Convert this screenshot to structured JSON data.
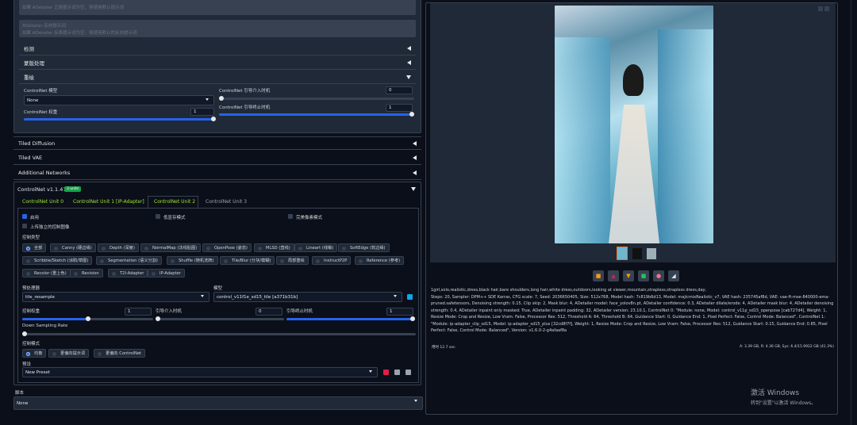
{
  "adetailer": {
    "neg_hint": "如果 ADetailer 正面提示词为空，将使用默认提示词",
    "neg_label": "ADetailer 反向提示词",
    "neg_hint2": "如果 ADetailer 反面提示词为空，将使用默认的反向提示词"
  },
  "sections": {
    "detect": "检测",
    "mask": "蒙版处理",
    "redraw": "重绘"
  },
  "cn_inner": {
    "model_label": "ControlNet 模型",
    "model_value": "None",
    "weight_label": "ControlNet 权重",
    "weight_value": "1",
    "guid_start_label": "ControlNet 引导介入时机",
    "guid_start_value": "0",
    "guid_end_label": "ControlNet 引导终止时机",
    "guid_end_value": "1"
  },
  "accordions": {
    "tiled_diffusion": "Tiled Diffusion",
    "tiled_vae": "Tiled VAE",
    "additional_networks": "Additional Networks"
  },
  "controlnet": {
    "title": "ControlNet v1.1.411",
    "badge": "3 units",
    "tabs": [
      "ControlNet Unit 0",
      "ControlNet Unit 1 [IP-Adapter]",
      "ControlNet Unit 2",
      "ControlNet Unit 3"
    ],
    "enable": "启用",
    "low_vram": "低显存模式",
    "pixel_perfect": "完美像素模式",
    "upload_independent": "上传独立的控制图像",
    "control_type_label": "控制类型",
    "control_types": [
      "全部",
      "Canny (硬边缘)",
      "Depth (深度)",
      "NormalMap (法线贴图)",
      "OpenPose (姿态)",
      "MLSD (直线)",
      "Lineart (线稿)",
      "SoftEdge (软边缘)",
      "Scribble/Sketch (涂鸦/草图)",
      "Segmentation (语义分割)",
      "Shuffle (随机洗牌)",
      "Tile/Blur (分块/模糊)",
      "局部重绘",
      "InstructP2P",
      "Reference (参考)",
      "Recolor (重上色)",
      "Revision",
      "T2I-Adapter",
      "IP-Adapter"
    ],
    "preprocessor_label": "预处理器",
    "preprocessor_value": "tile_resample",
    "model_label": "模型",
    "model_value": "control_v11f1e_sd15_tile [a371b31b]",
    "weight_label": "控制权重",
    "weight_value": "1",
    "start_label": "引导介入时机",
    "start_value": "0",
    "end_label": "引导终止时机",
    "end_value": "1",
    "downsample_label": "Down Sampling Rate",
    "downsample_value": "1",
    "mode_label": "控制模式",
    "modes": [
      "均衡",
      "更偏向提示词",
      "更偏向 ControlNet"
    ],
    "preset_label": "预设",
    "preset_value": "New Preset"
  },
  "script": {
    "label": "脚本",
    "value": "None"
  },
  "gallery": {
    "thumbs_count": 3
  },
  "info": {
    "prompt": "1girl,solo,realistic,dress,black hair,bare shoulders,long hair,white dress,outdoors,looking at viewer,mountain,strapless,strapless dress,day,",
    "params": "Steps: 20, Sampler: DPM++ SDE Karras, CFG scale: 7, Seed: 2036650405, Size: 512x768, Model hash: 7c819b6d13, Model: majicmixRealistic_v7, VAE hash: 235745af8d, VAE: vae-ft-mse-840000-ema-pruned.safetensors, Denoising strength: 0.15, Clip skip: 2, Mask blur: 4, ADetailer model: face_yolov8n.pt, ADetailer confidence: 0.3, ADetailer dilate/erode: 4, ADetailer mask blur: 4, ADetailer denoising strength: 0.4, ADetailer inpaint only masked: True, ADetailer inpaint padding: 32, ADetailer version: 23.10.1, ControlNet 0: \"Module: none, Model: control_v11p_sd15_openpose [cab727d4], Weight: 1, Resize Mode: Crop and Resize, Low Vram: False, Processor Res: 512, Threshold A: 64, Threshold B: 64, Guidance Start: 0, Guidance End: 1, Pixel Perfect: False, Control Mode: Balanced\", ControlNet 1: \"Module: ip-adapter_clip_sd15, Model: ip-adapter_sd15_plus [32cd8f7f], Weight: 1, Resize Mode: Crop and Resize, Low Vram: False, Processor Res: 512, Guidance Start: 0.15, Guidance End: 0.85, Pixel Perfect: False, Control Mode: Balanced\", Version: v1.6.0-2-g4afaaf8a",
    "time": "用时 12.7 sec.",
    "vram": "A: 3.39 GB, R: 4.36 GB, Sys: 6.4/15.9922 GB (41.3%)"
  },
  "watermark": {
    "line1": "激活 Windows",
    "line2": "转到\"设置\"以激活 Windows。"
  }
}
